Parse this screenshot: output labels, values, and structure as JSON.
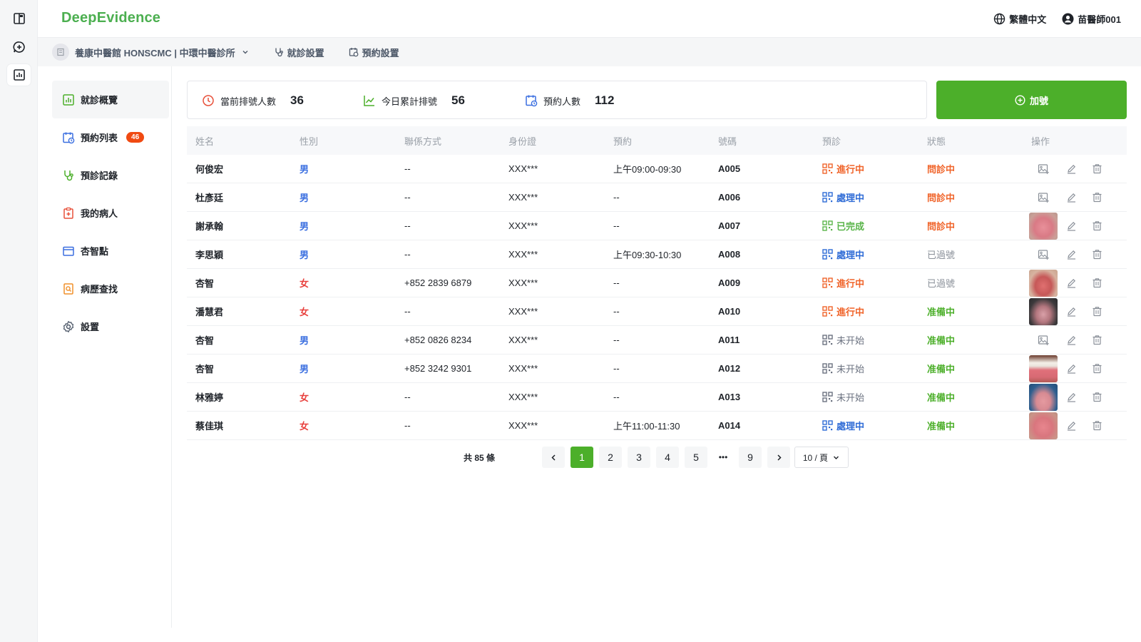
{
  "app": {
    "logo": "DeepEvidence"
  },
  "topbar": {
    "language": "繁體中文",
    "user": "苗醫師001"
  },
  "subbar": {
    "clinic": "養康中醫館 HONSCMC | 中環中醫診所",
    "visit_settings": "就診設置",
    "booking_settings": "預約設置"
  },
  "nav": [
    {
      "label": "就診概覽",
      "active": true
    },
    {
      "label": "預約列表",
      "badge": "46"
    },
    {
      "label": "預診記錄"
    },
    {
      "label": "我的病人"
    },
    {
      "label": "杏智點"
    },
    {
      "label": "病歷查找"
    },
    {
      "label": "設置"
    }
  ],
  "stats": [
    {
      "label": "當前排號人數",
      "value": "36"
    },
    {
      "label": "今日累計排號",
      "value": "56"
    },
    {
      "label": "預約人數",
      "value": "112"
    }
  ],
  "add_button": "加號",
  "table": {
    "columns": [
      "姓名",
      "性別",
      "聯係方式",
      "身份證",
      "預約",
      "號碼",
      "預診",
      "狀態",
      "操作"
    ],
    "rows": [
      {
        "name": "何俊宏",
        "gender": "男",
        "contact": "--",
        "id": "XXX***",
        "booking": "上午09:00-09:30",
        "number": "A005",
        "prediag": "進行中",
        "prediag_color": "orange",
        "status": "問診中",
        "status_color": "orange",
        "thumb": ""
      },
      {
        "name": "杜彥廷",
        "gender": "男",
        "contact": "--",
        "id": "XXX***",
        "booking": "--",
        "number": "A006",
        "prediag": "處理中",
        "prediag_color": "blue",
        "status": "問診中",
        "status_color": "orange",
        "thumb": ""
      },
      {
        "name": "謝承翰",
        "gender": "男",
        "contact": "--",
        "id": "XXX***",
        "booking": "--",
        "number": "A007",
        "prediag": "已完成",
        "prediag_color": "green",
        "status": "問診中",
        "status_color": "orange",
        "thumb": "tongue-pink"
      },
      {
        "name": "李思穎",
        "gender": "男",
        "contact": "--",
        "id": "XXX***",
        "booking": "上午09:30-10:30",
        "number": "A008",
        "prediag": "處理中",
        "prediag_color": "blue",
        "status": "已過號",
        "status_color": "gray",
        "thumb": ""
      },
      {
        "name": "杏智",
        "gender": "女",
        "contact": "+852 2839 6879",
        "id": "XXX***",
        "booking": "--",
        "number": "A009",
        "prediag": "進行中",
        "prediag_color": "orange",
        "status": "已過號",
        "status_color": "gray",
        "thumb": "tongue-red"
      },
      {
        "name": "潘慧君",
        "gender": "女",
        "contact": "--",
        "id": "XXX***",
        "booking": "--",
        "number": "A010",
        "prediag": "進行中",
        "prediag_color": "orange",
        "status": "准備中",
        "status_color": "green",
        "thumb": "tongue-dark"
      },
      {
        "name": "杏智",
        "gender": "男",
        "contact": "+852 0826 8234",
        "id": "XXX***",
        "booking": "--",
        "number": "A011",
        "prediag": "未开始",
        "prediag_color": "gray",
        "status": "准備中",
        "status_color": "green",
        "thumb": ""
      },
      {
        "name": "杏智",
        "gender": "男",
        "contact": "+852 3242 9301",
        "id": "XXX***",
        "booking": "--",
        "number": "A012",
        "prediag": "未开始",
        "prediag_color": "gray",
        "status": "准備中",
        "status_color": "green",
        "thumb": "tongue-teeth"
      },
      {
        "name": "林雅婷",
        "gender": "女",
        "contact": "--",
        "id": "XXX***",
        "booking": "--",
        "number": "A013",
        "prediag": "未开始",
        "prediag_color": "gray",
        "status": "准備中",
        "status_color": "green",
        "thumb": "tongue-blue"
      },
      {
        "name": "蔡佳琪",
        "gender": "女",
        "contact": "--",
        "id": "XXX***",
        "booking": "上午11:00-11:30",
        "number": "A014",
        "prediag": "處理中",
        "prediag_color": "blue",
        "status": "准備中",
        "status_color": "green",
        "thumb": "tongue-pink2"
      }
    ]
  },
  "pagination": {
    "total": "共 85 條",
    "pages": [
      "1",
      "2",
      "3",
      "4",
      "5",
      "•••",
      "9"
    ],
    "current": "1",
    "page_size": "10 / 頁"
  }
}
